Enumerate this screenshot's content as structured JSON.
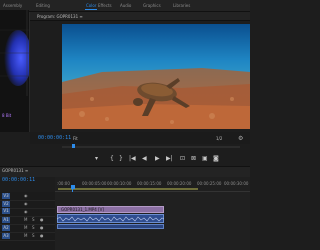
{
  "workspaces": [
    "Assembly",
    "Editing",
    "Color",
    "Effects",
    "Audio",
    "Graphics",
    "Libraries"
  ],
  "program": {
    "title": "Program: GOPR0131 ≡"
  },
  "monitor": {
    "timecode_left": "00:00:00:11",
    "fit_zoom": "Fit",
    "fraction": "1/2",
    "wrench_icon": "wrench-icon"
  },
  "scopes": {
    "readout": "8 Bit"
  },
  "controls": [
    "▾",
    "{",
    "}",
    "|◀",
    "◀",
    "▶",
    "▶|",
    "⊡",
    "⊠",
    "▣",
    "◙"
  ],
  "timeline": {
    "sequence_tab": "GOPR0131 ≡",
    "timecode": "00:00:00:11",
    "ticks": [
      ":00:00",
      "00:00:05:00",
      "00:00:10:00",
      "00:00:15:00",
      "00:00:20:00",
      "00:00:25:00",
      "00:00:30:00"
    ],
    "tracks": [
      {
        "label": "V3",
        "name": ""
      },
      {
        "label": "V2",
        "name": ""
      },
      {
        "label": "V1",
        "name": ""
      },
      {
        "label": "A1",
        "name": ""
      },
      {
        "label": "A2",
        "name": ""
      },
      {
        "label": "A3",
        "name": ""
      }
    ],
    "clip_video_label": "GOPR0131_1.MP4 [V]"
  },
  "colors": {
    "accent": "#2d8ceb",
    "video_clip": "#8b6fa3",
    "audio_clip": "#2f4d8f"
  }
}
